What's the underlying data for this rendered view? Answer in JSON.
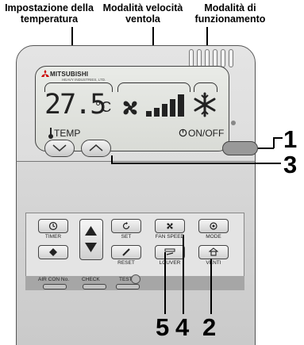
{
  "labels": {
    "temperature": "Impostazione della temperatura",
    "fan_speed_mode": "Modalità velocità ventola",
    "operating_mode": "Modalità di funzionamento"
  },
  "display": {
    "brand": "MITSUBISHI",
    "brand_sub": "HEAVY INDUSTRIES, LTD.",
    "temperature_value": "27.5",
    "temperature_unit": "°C",
    "fan_level": 4,
    "temp_label": "TEMP",
    "onoff_label": "ON/OFF"
  },
  "buttons": {
    "timer": "TIMER",
    "set": "SET",
    "reset": "RESET",
    "fan_speed": "FAN SPEED",
    "mode": "MODE",
    "louver": "LOUVER",
    "venti": "VENTI",
    "air_con_no": "AIR CON No.",
    "check": "CHECK",
    "test": "TEST"
  },
  "callouts": {
    "c1": "1",
    "c3": "3",
    "c5": "5",
    "c4": "4",
    "c2": "2"
  },
  "icons": [
    "thermometer-icon",
    "power-icon",
    "fan-icon",
    "snowflake-icon",
    "clock-icon",
    "diamond-icon",
    "triangle-up-icon",
    "triangle-down-icon",
    "circular-arrow-icon",
    "pencil-icon",
    "louver-icon",
    "house-icon"
  ]
}
